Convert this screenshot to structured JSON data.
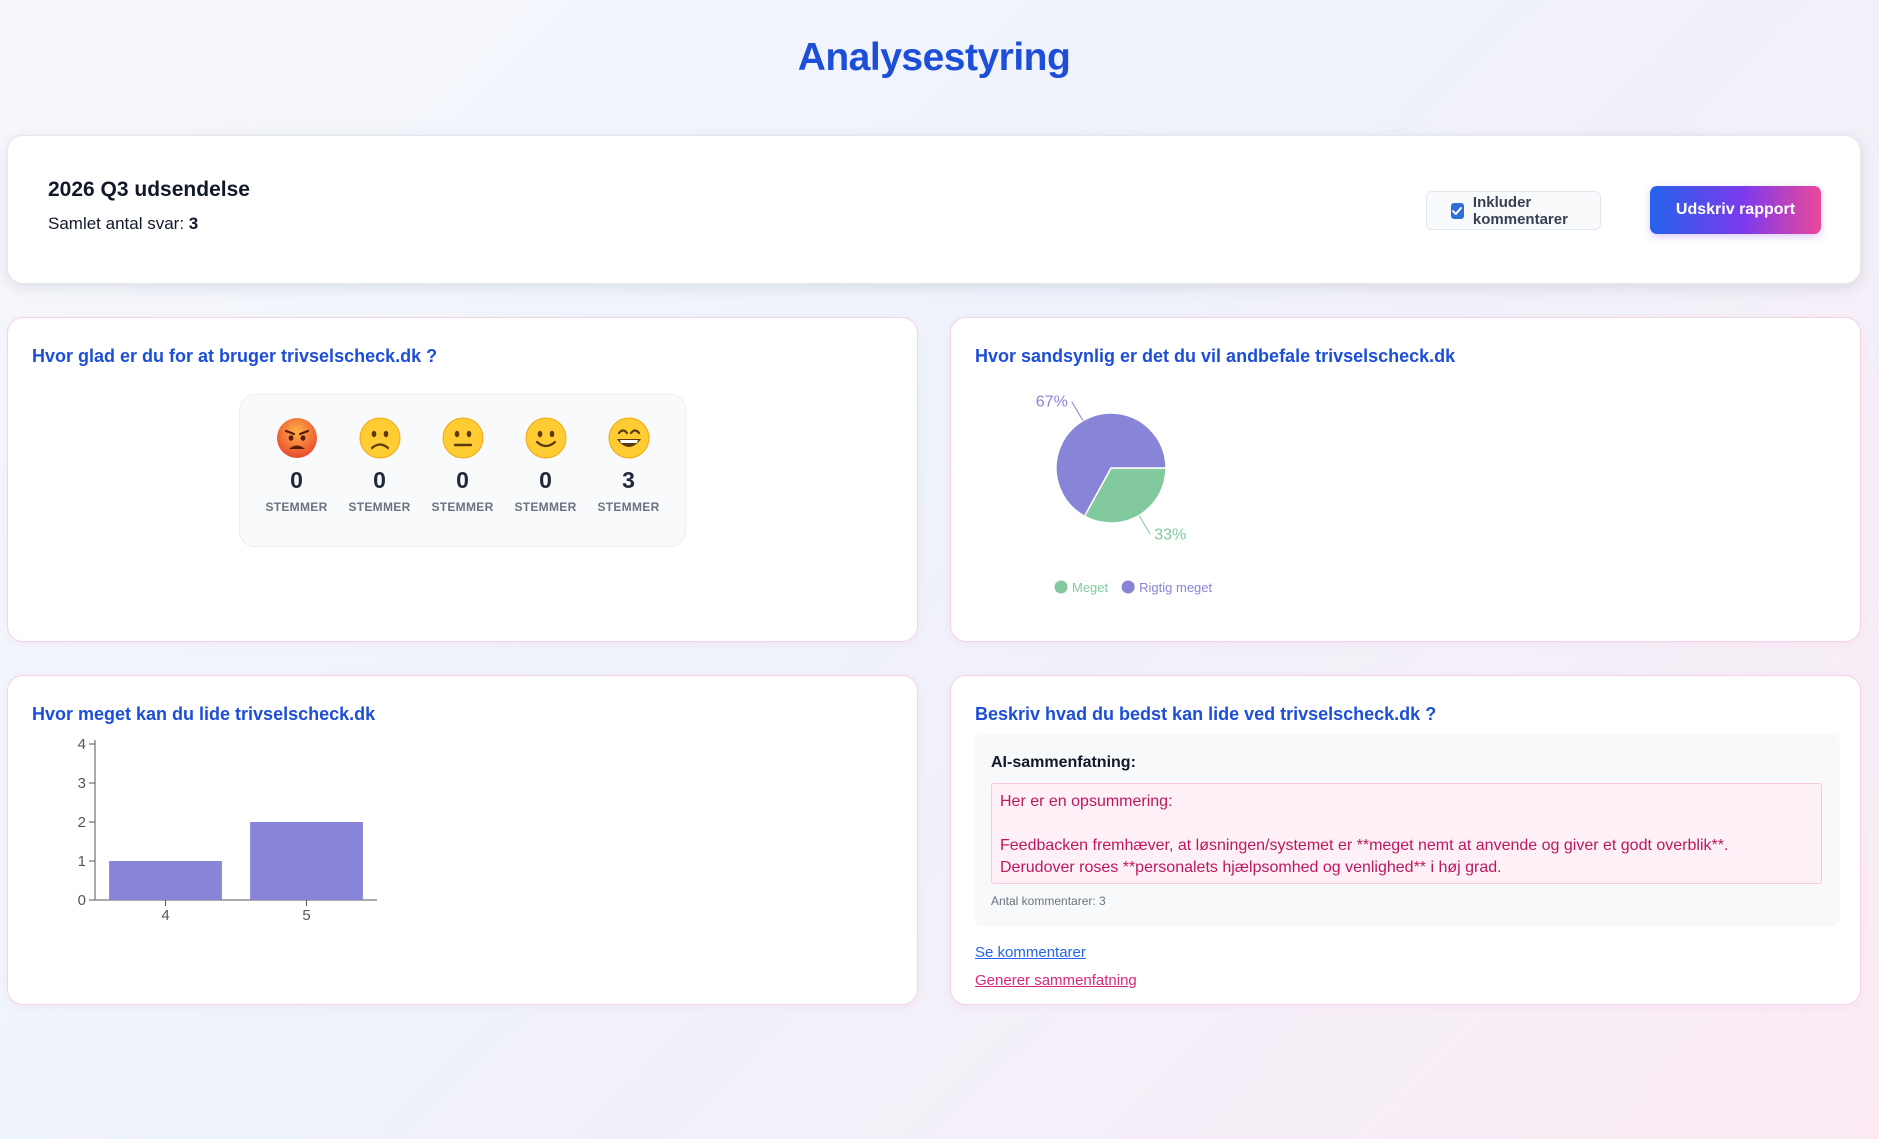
{
  "page": {
    "title": "Analysestyring"
  },
  "header": {
    "sending_title": "2026 Q3 udsendelse",
    "total_label": "Samlet antal svar: ",
    "total_value": "3",
    "include_comments_label": "Inkluder kommentarer",
    "include_comments_checked": true,
    "print_button_label": "Udskriv rapport"
  },
  "q1": {
    "title": "Hvor glad er du for at bruger trivselscheck.dk ?",
    "options": [
      {
        "icon": "angry-face-icon",
        "count": "0",
        "unit": "STEMMER"
      },
      {
        "icon": "slightly-frowning-face-icon",
        "count": "0",
        "unit": "STEMMER"
      },
      {
        "icon": "neutral-face-icon",
        "count": "0",
        "unit": "STEMMER"
      },
      {
        "icon": "slightly-smiling-face-icon",
        "count": "0",
        "unit": "STEMMER"
      },
      {
        "icon": "grinning-face-icon",
        "count": "3",
        "unit": "STEMMER"
      }
    ]
  },
  "q2": {
    "title": "Hvor sandsynlig er det du vil andbefale trivselscheck.dk"
  },
  "q3": {
    "title": "Hvor meget kan du lide trivselscheck.dk"
  },
  "q4": {
    "title": "Beskriv hvad du bedst kan lide ved trivselscheck.dk ?",
    "summary_heading": "AI-sammenfatning:",
    "summary_lines": [
      "Her er en opsummering:",
      "",
      "Feedbacken fremhæver, at løsningen/systemet er **meget nemt at anvende og giver et godt overblik**.",
      "Derudover roses **personalets hjælpsomhed og venlighed** i høj grad."
    ],
    "comment_count": "Antal kommentarer: 3",
    "see_comments_link": "Se kommentarer",
    "generate_summary_link": "Generer sammenfatning"
  },
  "chart_data": [
    {
      "type": "pie",
      "slices": [
        {
          "name": "Meget",
          "value": 33,
          "label": "33%",
          "color": "#82ca9d"
        },
        {
          "name": "Rigtig meget",
          "value": 67,
          "label": "67%",
          "color": "#8884d8"
        }
      ],
      "legend": "bottom"
    },
    {
      "type": "bar",
      "categories": [
        "4",
        "5"
      ],
      "values": [
        1,
        2
      ],
      "ylim": [
        0,
        4
      ],
      "yticks": [
        0,
        1,
        2,
        3,
        4
      ],
      "color": "#8884d8"
    }
  ],
  "colors": {
    "accent_blue": "#1d4ed8",
    "accent_pink": "#db2777",
    "chart_purple": "#8884d8",
    "chart_green": "#82ca9d"
  }
}
